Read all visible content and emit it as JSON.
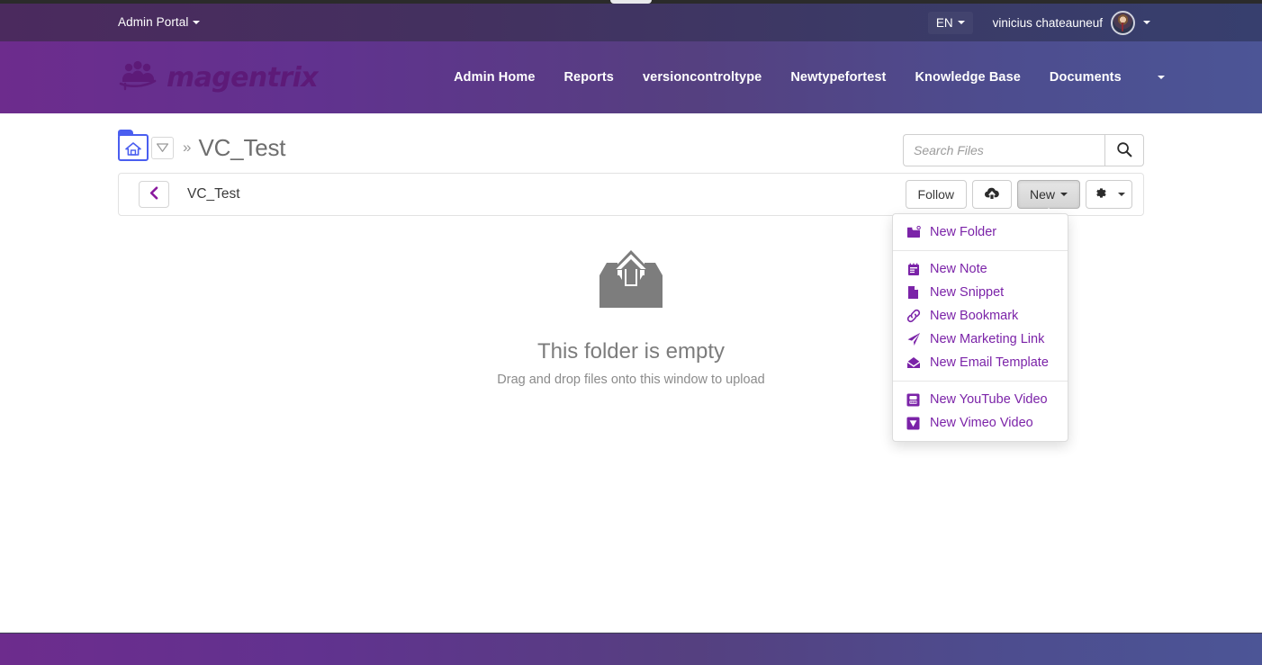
{
  "topbar": {
    "admin_portal_label": "Admin Portal",
    "language_label": "EN",
    "user_name": "vinicius chateauneuf"
  },
  "navbar": {
    "brand": "magentrix",
    "links": [
      {
        "label": "Admin Home"
      },
      {
        "label": "Reports"
      },
      {
        "label": "versioncontroltype"
      },
      {
        "label": "Newtypefortest"
      },
      {
        "label": "Knowledge Base"
      },
      {
        "label": "Documents"
      }
    ]
  },
  "breadcrumb": {
    "home_icon": "home-folder-icon",
    "separator": "»",
    "current": "VC_Test"
  },
  "search": {
    "placeholder": "Search Files",
    "value": "",
    "icon": "search-icon"
  },
  "toolbar": {
    "back_icon": "chevron-left-icon",
    "folder_name": "VC_Test",
    "follow_label": "Follow",
    "upload_icon": "cloud-upload-icon",
    "new_label": "New",
    "settings_icon": "gear-icon"
  },
  "new_menu": {
    "groups": [
      {
        "items": [
          {
            "label": "New Folder",
            "icon": "folder-plus-icon"
          }
        ]
      },
      {
        "items": [
          {
            "label": "New Note",
            "icon": "note-icon"
          },
          {
            "label": "New Snippet",
            "icon": "document-icon"
          },
          {
            "label": "New Bookmark",
            "icon": "link-icon"
          },
          {
            "label": "New Marketing Link",
            "icon": "paper-plane-icon"
          },
          {
            "label": "New Email Template",
            "icon": "envelope-open-icon"
          }
        ]
      },
      {
        "items": [
          {
            "label": "New YouTube Video",
            "icon": "youtube-icon"
          },
          {
            "label": "New Vimeo Video",
            "icon": "vimeo-icon"
          }
        ]
      }
    ]
  },
  "empty_state": {
    "icon": "upload-inbox-icon",
    "title": "This folder is empty",
    "subtitle": "Drag and drop files onto this window to upload"
  },
  "colors": {
    "brand_purple": "#6d2c8d",
    "brand_blue": "#4c5596",
    "menu_link": "#7b23a8",
    "breadcrumb_accent": "#4a5ef0",
    "empty_gray": "#7c7c7c"
  }
}
